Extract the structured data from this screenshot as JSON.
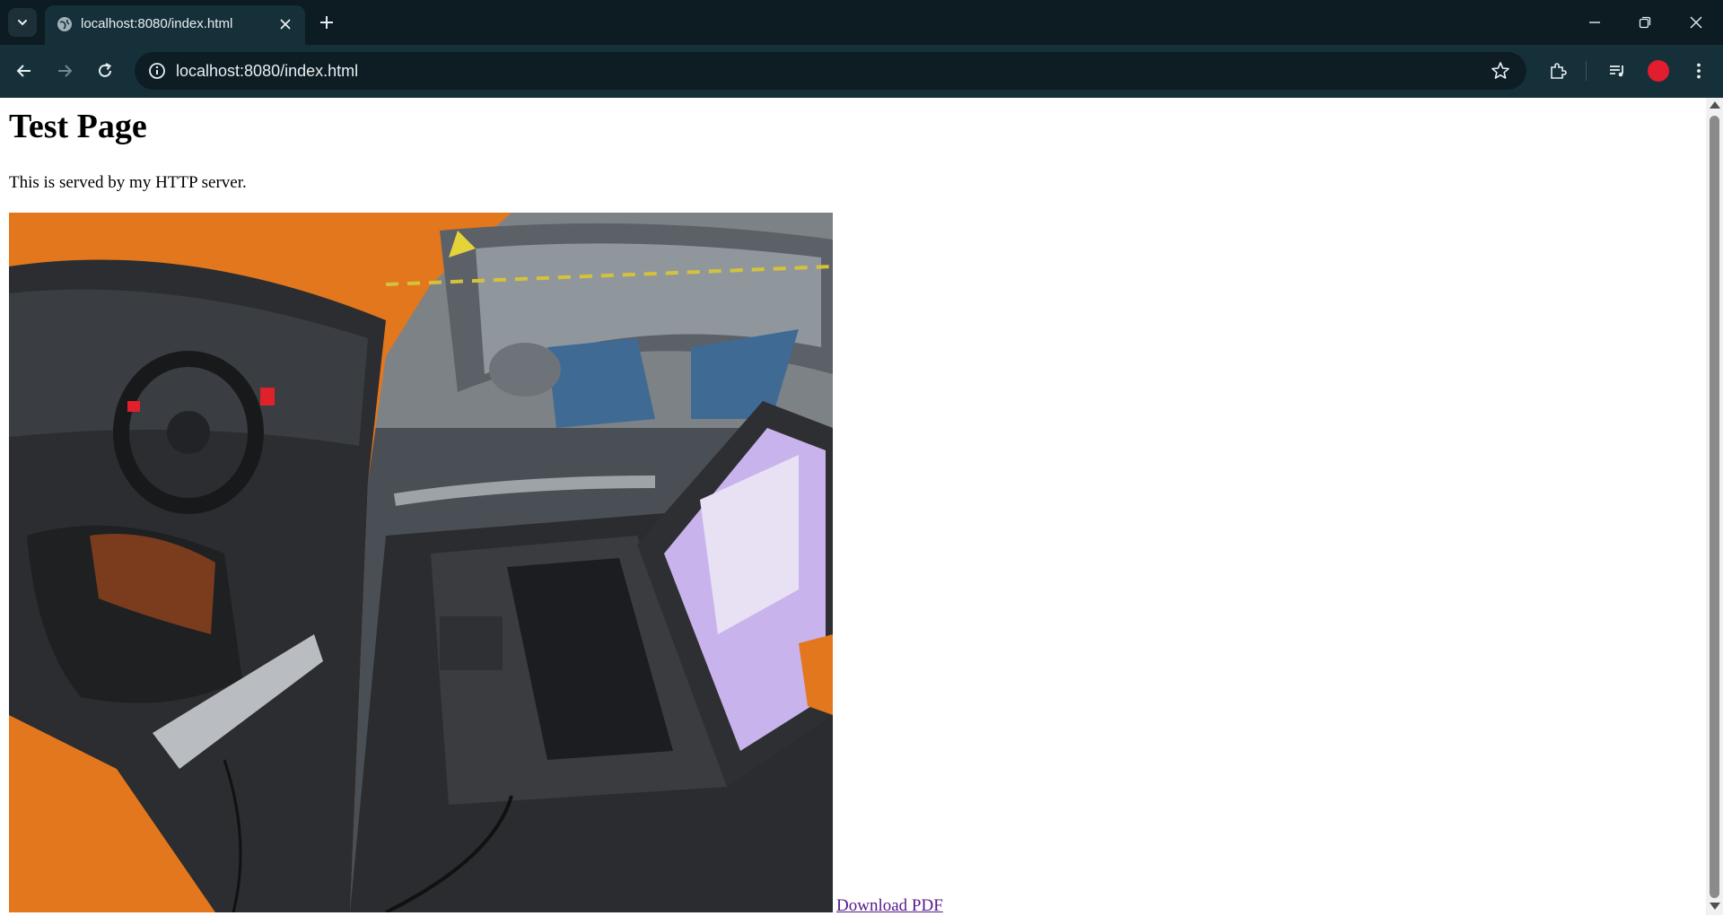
{
  "browser": {
    "tab": {
      "title": "localhost:8080/index.html"
    },
    "address_bar": {
      "url": "localhost:8080/index.html"
    },
    "icons": [
      "tab-search-icon",
      "globe-icon",
      "close-icon",
      "plus-icon",
      "minimize-icon",
      "restore-icon",
      "window-close-icon",
      "back-icon",
      "forward-icon",
      "reload-icon",
      "info-icon",
      "star-icon",
      "extensions-icon",
      "media-icon",
      "menu-icon"
    ],
    "colors": {
      "frame": "#0c1c22",
      "toolbar": "#16303a",
      "omnibox": "#0d1d23",
      "profile": "#e11d2e"
    }
  },
  "page": {
    "heading": "Test Page",
    "paragraph": "This is served by my HTTP server.",
    "link": "Download PDF",
    "colors": {
      "link": "#551a8b"
    }
  }
}
